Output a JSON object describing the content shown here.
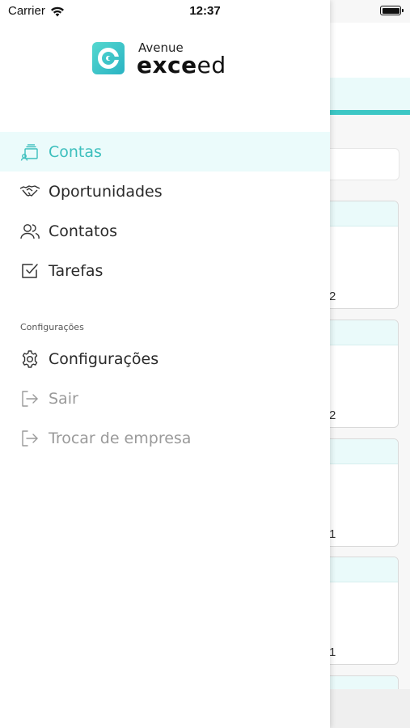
{
  "status_bar": {
    "carrier": "Carrier",
    "time": "12:37"
  },
  "logo": {
    "line1": "Avenue",
    "word_part1": "exce",
    "word_part2": "ed"
  },
  "menu": {
    "items": [
      {
        "label": "Contas",
        "icon": "accounts-icon",
        "active": true
      },
      {
        "label": "Oportunidades",
        "icon": "handshake-icon",
        "active": false
      },
      {
        "label": "Contatos",
        "icon": "users-icon",
        "active": false
      },
      {
        "label": "Tarefas",
        "icon": "checkbox-icon",
        "active": false
      }
    ],
    "section_label": "Configurações",
    "settings_items": [
      {
        "label": "Configurações",
        "icon": "gear-icon"
      },
      {
        "label": "Sair",
        "icon": "logout-icon"
      },
      {
        "label": "Trocar de empresa",
        "icon": "switch-company-icon"
      }
    ]
  },
  "background": {
    "card_values": [
      "2",
      "2",
      "1",
      "1"
    ]
  },
  "colors": {
    "accent": "#3cbfbd",
    "active_bg": "#ebfbfb",
    "muted": "#9a9a9a"
  }
}
